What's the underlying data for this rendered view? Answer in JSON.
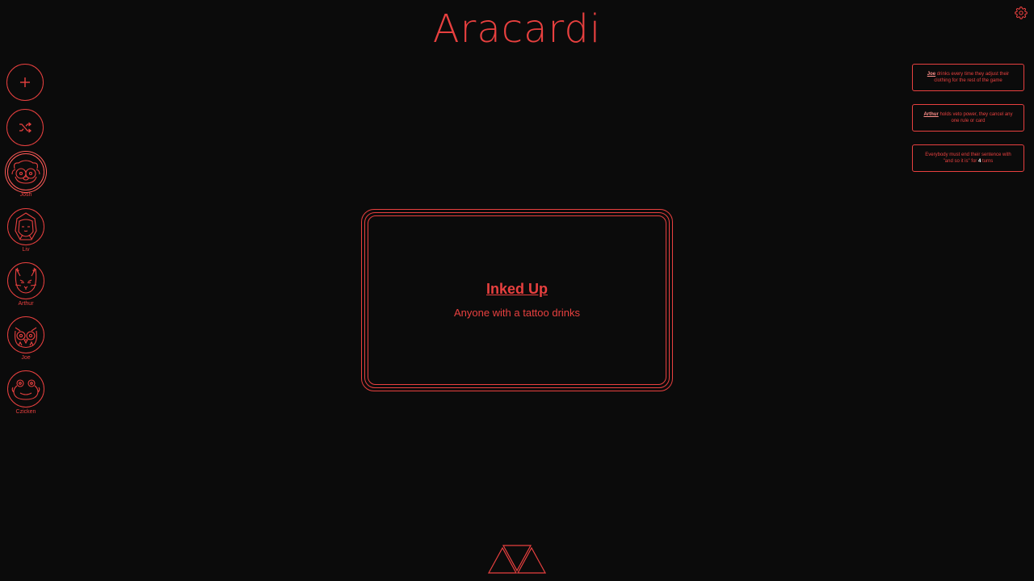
{
  "app": {
    "title": "Aracardi"
  },
  "colors": {
    "accent": "#e8403f",
    "background": "#0b0b0b"
  },
  "toolbar": {
    "add_icon": "plus-icon",
    "shuffle_icon": "shuffle-icon",
    "settings_icon": "gear-icon"
  },
  "players": [
    {
      "name": "Josh",
      "avatar": "dog-face-icon",
      "active": true
    },
    {
      "name": "Liv",
      "avatar": "hooded-face-icon"
    },
    {
      "name": "Arthur",
      "avatar": "cat-face-icon"
    },
    {
      "name": "Joe",
      "avatar": "owl-face-icon"
    },
    {
      "name": "Czicken",
      "avatar": "frog-face-icon"
    }
  ],
  "rules": [
    {
      "player": "Joe",
      "text": " drinks every time they adjust their clothing for the rest of the game"
    },
    {
      "player": "Arthur",
      "text": " holds veto power, they cancel any one rule or card"
    },
    {
      "pre": "Everybody must end their sentence with \"and so it is\" for ",
      "count": "4",
      "post": " turns"
    }
  ],
  "card": {
    "title": "Inked Up",
    "text": "Anyone with a tattoo drinks"
  },
  "footer": {
    "logo": "triangles-logo-icon"
  }
}
